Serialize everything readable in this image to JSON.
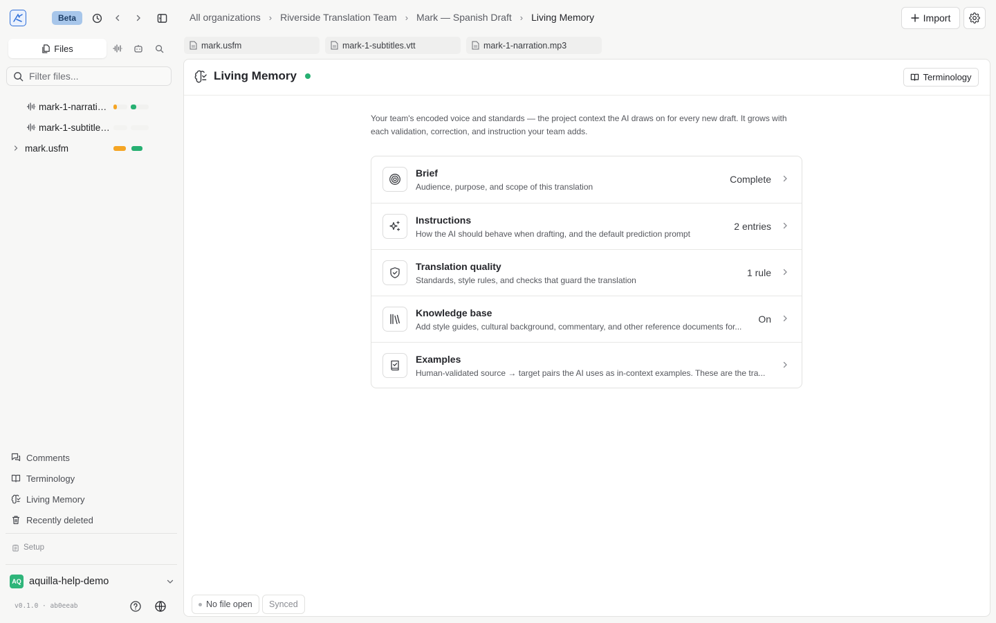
{
  "app": {
    "beta_label": "Beta"
  },
  "breadcrumb": [
    "All organizations",
    "Riverside Translation Team",
    "Mark — Spanish Draft",
    "Living Memory"
  ],
  "header": {
    "import_label": "Import"
  },
  "file_tabs": [
    "mark.usfm",
    "mark-1-subtitles.vtt",
    "mark-1-narration.mp3"
  ],
  "sidebar": {
    "files_tab_label": "Files",
    "filter_placeholder": "Filter files...",
    "files": [
      {
        "name": "mark-1-narratio…",
        "icon": "waveform-icon",
        "progress_a": 0.25,
        "progress_b": 0.3,
        "color_a": "#f5a524",
        "color_b": "#27b072"
      },
      {
        "name": "mark-1-subtitles…",
        "icon": "waveform-icon",
        "progress_a": 0,
        "progress_b": 0,
        "color_a": "#f5a524",
        "color_b": "#27b072"
      },
      {
        "name": "mark.usfm",
        "icon": "chevron-right-icon",
        "progress_a": 1.0,
        "progress_b": 1.0,
        "color_a": "#f5a524",
        "color_b": "#27b072"
      }
    ],
    "nav": [
      {
        "label": "Comments",
        "icon": "comments-icon"
      },
      {
        "label": "Terminology",
        "icon": "book-icon"
      },
      {
        "label": "Living Memory",
        "icon": "brain-icon"
      },
      {
        "label": "Recently deleted",
        "icon": "trash-icon"
      }
    ],
    "setup_label": "Setup",
    "org": {
      "initials": "AQ",
      "name": "aquilla-help-demo"
    },
    "version": "v0.1.0 · ab0eeab"
  },
  "main": {
    "title": "Living Memory",
    "terminology_button": "Terminology",
    "intro": "Your team's encoded voice and standards — the project context the AI draws on for every new draft. It grows with each validation, correction, and instruction your team adds.",
    "cards": [
      {
        "title": "Brief",
        "desc": "Audience, purpose, and scope of this translation",
        "status": "Complete",
        "icon": "target-icon"
      },
      {
        "title": "Instructions",
        "desc": "How the AI should behave when drafting, and the default prediction prompt",
        "status": "2 entries",
        "icon": "sparkles-icon"
      },
      {
        "title": "Translation quality",
        "desc": "Standards, style rules, and checks that guard the translation",
        "status": "1 rule",
        "icon": "shield-check-icon"
      },
      {
        "title": "Knowledge base",
        "desc": "Add style guides, cultural background, commentary, and other reference documents for...",
        "status": "On",
        "icon": "library-icon"
      },
      {
        "title": "Examples",
        "desc": "Human-validated source → target pairs the AI uses as in-context examples. These are the tra...",
        "status": "",
        "icon": "book-check-icon"
      }
    ]
  },
  "status_bar": {
    "file_status": "No file open",
    "sync_status": "Synced"
  }
}
